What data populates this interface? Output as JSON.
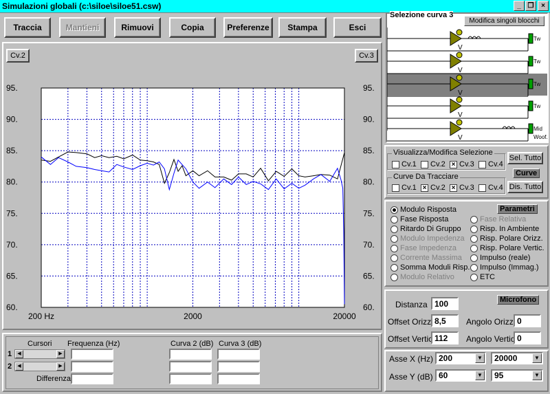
{
  "window": {
    "title": "Simulazioni globali (c:\\siloe\\siloe51.csw)",
    "btn_min": "_",
    "btn_max": "❐",
    "btn_close": "×"
  },
  "toolbar": {
    "traccia": "Traccia",
    "mantieni": "Mantieni",
    "rimuovi": "Rimuovi",
    "copia": "Copia",
    "preferenze": "Preferenze",
    "stampa": "Stampa",
    "esci": "Esci"
  },
  "chart": {
    "left_btn": "Cv.2",
    "right_btn": "Cv.3"
  },
  "chart_data": {
    "type": "line",
    "x_scale": "log",
    "xlim": [
      200,
      20000
    ],
    "ylim": [
      60,
      95
    ],
    "x_tick_labels": [
      "200 Hz",
      "2000",
      "20000"
    ],
    "x_ticks": [
      200,
      2000,
      20000
    ],
    "y_ticks": [
      60,
      65,
      70,
      75,
      80,
      85,
      90,
      95
    ],
    "y_tick_labels": [
      "60.",
      "65.",
      "70.",
      "75.",
      "80.",
      "85.",
      "90.",
      "95."
    ],
    "grid": true,
    "series": [
      {
        "color": "#000000",
        "x": [
          200,
          230,
          260,
          300,
          340,
          400,
          450,
          500,
          560,
          630,
          700,
          800,
          900,
          1000,
          1100,
          1200,
          1300,
          1400,
          1500,
          1600,
          1700,
          1800,
          2000,
          2200,
          2500,
          2800,
          3200,
          3600,
          4000,
          4500,
          5000,
          5600,
          6300,
          7100,
          8000,
          9000,
          10000,
          11000,
          12500,
          14000,
          16000,
          18000,
          20000
        ],
        "y": [
          83.5,
          83.3,
          84.0,
          84.8,
          84.7,
          84.5,
          83.9,
          84.2,
          83.9,
          84.1,
          83.7,
          84.3,
          83.5,
          83.4,
          83.2,
          82.8,
          79.8,
          81.5,
          83.6,
          81.7,
          82.6,
          81.0,
          81.8,
          81.0,
          81.8,
          80.8,
          80.8,
          80.3,
          81.3,
          81.3,
          80.8,
          82.2,
          80.2,
          81.7,
          80.9,
          82.1,
          81.0,
          80.8,
          81.0,
          81.2,
          81.1,
          80.5,
          84.7
        ]
      },
      {
        "color": "#0000ff",
        "x": [
          200,
          230,
          260,
          300,
          340,
          400,
          450,
          500,
          560,
          630,
          700,
          800,
          900,
          1000,
          1100,
          1200,
          1300,
          1400,
          1500,
          1600,
          1800,
          2000,
          2200,
          2500,
          2800,
          3200,
          3600,
          4000,
          4500,
          5000,
          5600,
          6300,
          7100,
          8000,
          9000,
          10000,
          11000,
          12500,
          14000,
          16000,
          18000,
          19000,
          19500,
          19800,
          20000
        ],
        "y": [
          84.0,
          82.8,
          83.9,
          83.2,
          82.5,
          82.3,
          82.0,
          81.8,
          81.6,
          82.8,
          82.4,
          82.0,
          82.6,
          83.0,
          82.7,
          83.2,
          82.1,
          78.8,
          81.4,
          83.5,
          82.1,
          80.0,
          79.0,
          80.0,
          79.1,
          80.5,
          79.6,
          80.8,
          79.6,
          80.1,
          79.7,
          78.8,
          80.5,
          78.9,
          79.8,
          79.0,
          79.5,
          80.5,
          81.2,
          80.1,
          82.2,
          80.3,
          79.0,
          72.0,
          60.5
        ]
      }
    ]
  },
  "selector": {
    "title": "Selezione curva 3",
    "modifica_btn": "Modifica singoli blocchi",
    "rows": [
      {
        "label": "V",
        "out": "Tw"
      },
      {
        "label": "V",
        "out": "Tw"
      },
      {
        "label": "V",
        "out": "Tw"
      },
      {
        "label": "V",
        "out": "Tw"
      },
      {
        "label": "V",
        "out": "Mid"
      }
    ],
    "woof_label": "Woof."
  },
  "visualizza": {
    "caption": "Visualizza/Modifica Selezione",
    "cv1": "Cv.1",
    "cv2": "Cv.2",
    "cv3": "Cv.3",
    "cv4": "Cv.4",
    "sel_tutto": "Sel. Tutto",
    "curve_hdr": "Curve",
    "caption2": "Curve Da Tracciare",
    "dis_tutto": "Dis. Tutto",
    "checked_mark": "×"
  },
  "parametri": {
    "header": "Parametri",
    "left": [
      {
        "label": "Modulo Risposta",
        "state": "on"
      },
      {
        "label": "Fase Risposta",
        "state": "off"
      },
      {
        "label": "Ritardo Di Gruppo",
        "state": "off"
      },
      {
        "label": "Modulo Impedenza",
        "state": "disabled"
      },
      {
        "label": "Fase Impedenza",
        "state": "disabled"
      },
      {
        "label": "Corrente Massima",
        "state": "disabled"
      },
      {
        "label": "Somma Moduli Risp.",
        "state": "off"
      },
      {
        "label": "Modulo Relativo",
        "state": "disabled"
      }
    ],
    "right": [
      {
        "label": "Fase Relativa",
        "state": "disabled"
      },
      {
        "label": "Risp. In Ambiente",
        "state": "off"
      },
      {
        "label": "Risp. Polare Orizz.",
        "state": "off"
      },
      {
        "label": "Risp. Polare Vertic.",
        "state": "off"
      },
      {
        "label": "Impulso (reale)",
        "state": "off"
      },
      {
        "label": "Impulso (Immag.)",
        "state": "off"
      },
      {
        "label": "ETC",
        "state": "off"
      }
    ]
  },
  "microfono": {
    "header": "Microfono",
    "distanza_label": "Distanza",
    "distanza": "100",
    "offset_orizz_label": "Offset Orizz.",
    "offset_orizz": "8,5",
    "angolo_orizz_label": "Angolo Orizz.",
    "angolo_orizz": "0",
    "offset_vertic_label": "Offset Vertic.",
    "offset_vertic": "112",
    "angolo_vertic_label": "Angolo Vertic.",
    "angolo_vertic": "0"
  },
  "axes": {
    "x_label": "Asse X  (Hz)",
    "x_min": "200",
    "x_max": "20000",
    "y_label": "Asse Y  (dB)",
    "y_min": "60",
    "y_max": "95"
  },
  "cursori": {
    "cursori_label": "Cursori",
    "freq_label": "Frequenza (Hz)",
    "curva2_label": "Curva 2 (dB)",
    "curva3_label": "Curva 3 (dB)",
    "row1": "1",
    "row2": "2",
    "differenza_label": "Differenza"
  }
}
